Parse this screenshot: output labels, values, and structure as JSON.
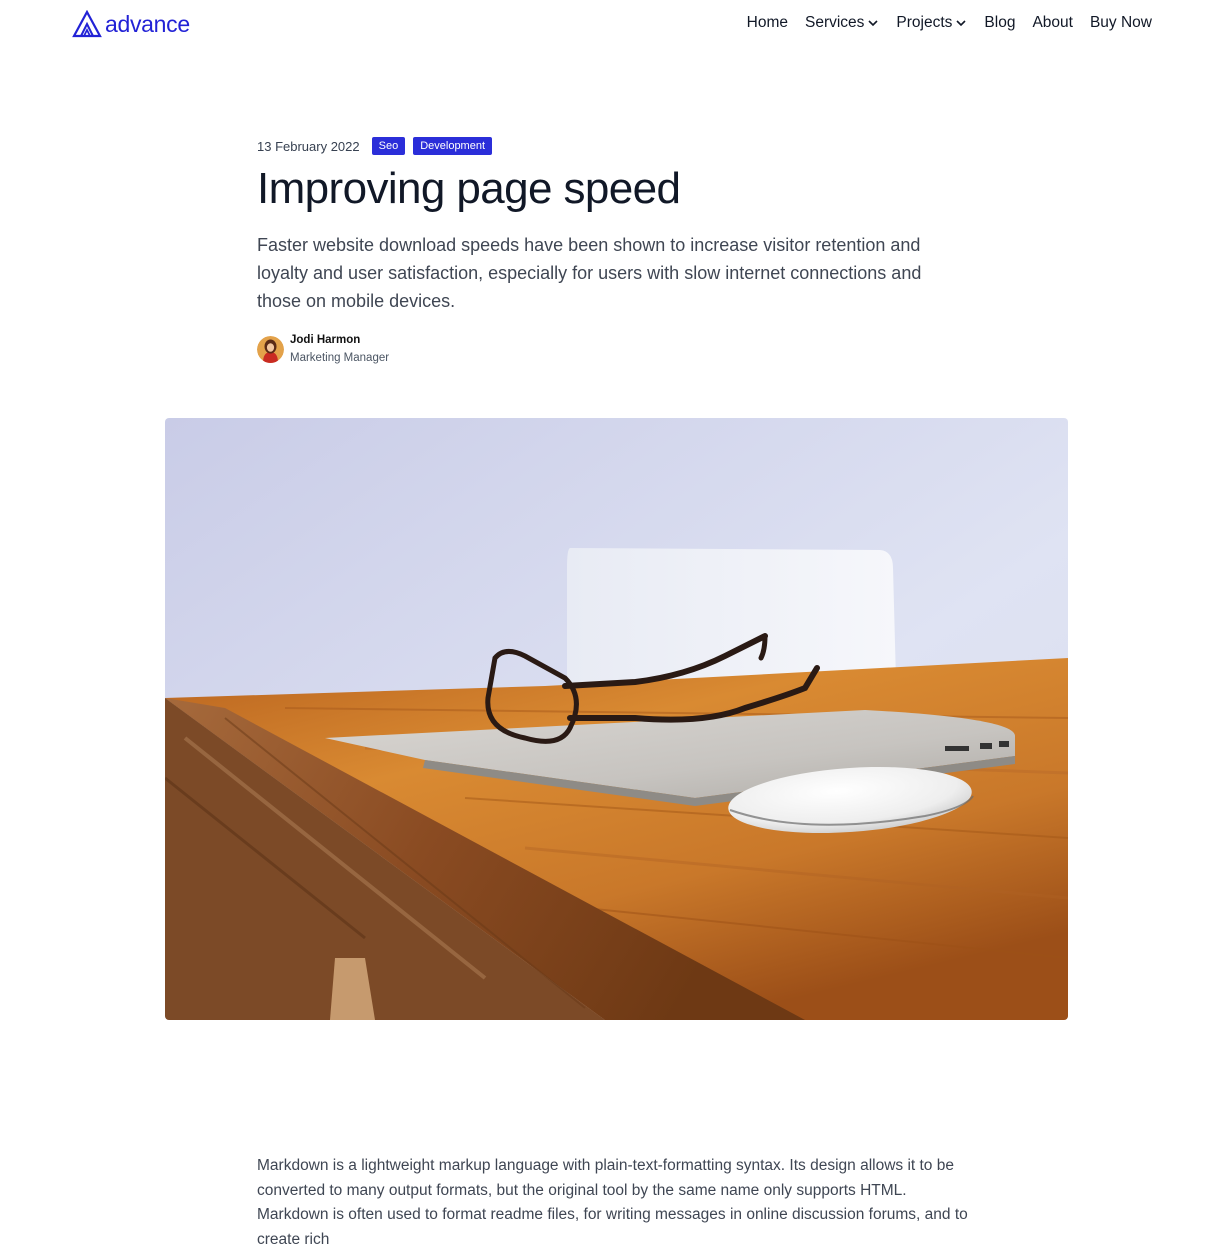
{
  "header": {
    "logo_text": "advance",
    "nav": [
      {
        "label": "Home"
      },
      {
        "label": "Services"
      },
      {
        "label": "Projects"
      },
      {
        "label": "Blog"
      },
      {
        "label": "About"
      },
      {
        "label": "Buy Now"
      }
    ]
  },
  "article": {
    "date": "13 February 2022",
    "tags": [
      "Seo",
      "Development"
    ],
    "title": "Improving page speed",
    "lede": "Faster website download speeds have been shown to increase visitor retention and loyalty and user satisfaction, especially for users with slow internet connections and those on mobile devices.",
    "author": {
      "name": "Jodi Harmon",
      "role": "Marketing Manager"
    },
    "body": "Markdown is a lightweight markup language with plain-text-formatting syntax. Its design allows it to be converted to many output formats, but the original tool by the same name only supports HTML. Markdown is often used to format readme files, for writing messages in online discussion forums, and to create rich"
  },
  "colors": {
    "brand": "#2222d6",
    "tag_bg": "#2b2ed9"
  },
  "icons": {
    "logo": "advance-logo-icon",
    "dropdown": "chevron-down-icon"
  }
}
